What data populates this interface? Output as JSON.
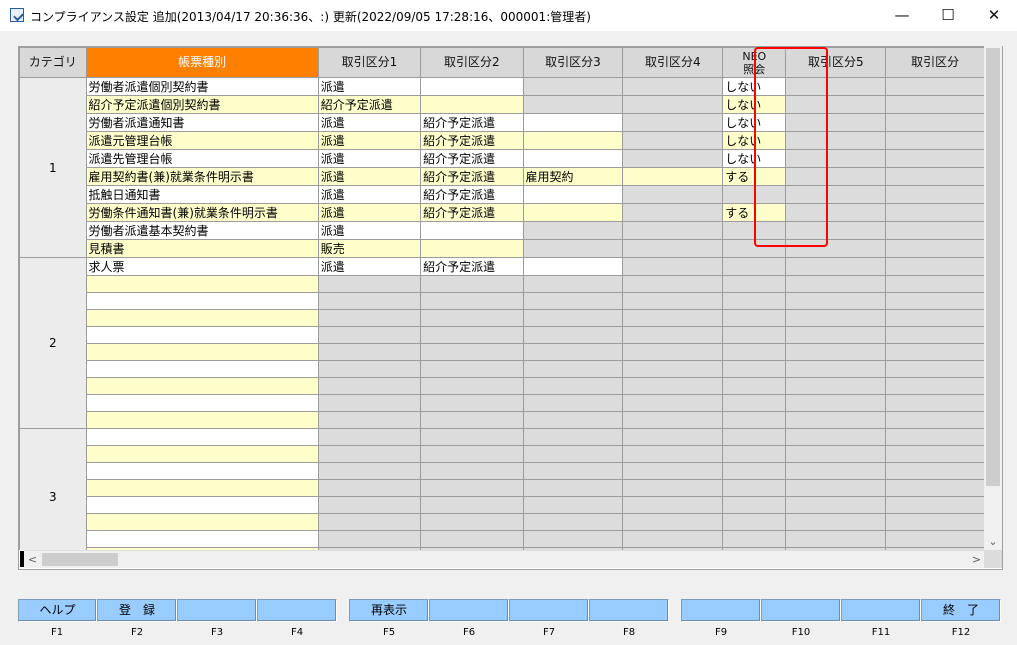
{
  "window": {
    "title": "コンプライアンス設定 追加(2013/04/17 20:36:36、:) 更新(2022/09/05 17:28:16、000001:管理者)",
    "minimize": "—",
    "maximize": "☐",
    "close": "✕"
  },
  "grid": {
    "headers": [
      "カテゴリ",
      "帳票種別",
      "取引区分1",
      "取引区分2",
      "取引区分3",
      "取引区分4",
      "NEO\n照会",
      "取引区分5",
      "取引区分"
    ],
    "categories": [
      {
        "label": "1",
        "rows": [
          [
            "労働者派遣個別契約書",
            "派遣",
            "",
            "",
            "",
            "しない",
            "",
            ""
          ],
          [
            "紹介予定派遣個別契約書",
            "紹介予定派遣",
            "",
            "",
            "",
            "しない",
            "",
            ""
          ],
          [
            "労働者派遣通知書",
            "派遣",
            "紹介予定派遣",
            "",
            "",
            "しない",
            "",
            ""
          ],
          [
            "派遣元管理台帳",
            "派遣",
            "紹介予定派遣",
            "",
            "",
            "しない",
            "",
            ""
          ],
          [
            "派遣先管理台帳",
            "派遣",
            "紹介予定派遣",
            "",
            "",
            "しない",
            "",
            ""
          ],
          [
            "雇用契約書(兼)就業条件明示書",
            "派遣",
            "紹介予定派遣",
            "雇用契約",
            "",
            "する",
            "",
            ""
          ],
          [
            "抵触日通知書",
            "派遣",
            "紹介予定派遣",
            "",
            "",
            "",
            "",
            ""
          ],
          [
            "労働条件通知書(兼)就業条件明示書",
            "派遣",
            "紹介予定派遣",
            "",
            "",
            "する",
            "",
            ""
          ],
          [
            "労働者派遣基本契約書",
            "派遣",
            "",
            "",
            "",
            "",
            "",
            ""
          ],
          [
            "見積書",
            "販売",
            "",
            "",
            "",
            "",
            "",
            ""
          ]
        ]
      },
      {
        "label": "2",
        "rows": [
          [
            "求人票",
            "派遣",
            "紹介予定派遣",
            "",
            "",
            "",
            "",
            ""
          ],
          [
            "",
            "",
            "",
            "",
            "",
            "",
            "",
            ""
          ],
          [
            "",
            "",
            "",
            "",
            "",
            "",
            "",
            ""
          ],
          [
            "",
            "",
            "",
            "",
            "",
            "",
            "",
            ""
          ],
          [
            "",
            "",
            "",
            "",
            "",
            "",
            "",
            ""
          ],
          [
            "",
            "",
            "",
            "",
            "",
            "",
            "",
            ""
          ],
          [
            "",
            "",
            "",
            "",
            "",
            "",
            "",
            ""
          ],
          [
            "",
            "",
            "",
            "",
            "",
            "",
            "",
            ""
          ],
          [
            "",
            "",
            "",
            "",
            "",
            "",
            "",
            ""
          ],
          [
            "",
            "",
            "",
            "",
            "",
            "",
            "",
            ""
          ]
        ]
      },
      {
        "label": "3",
        "rows": [
          [
            "",
            "",
            "",
            "",
            "",
            "",
            "",
            ""
          ],
          [
            "",
            "",
            "",
            "",
            "",
            "",
            "",
            ""
          ],
          [
            "",
            "",
            "",
            "",
            "",
            "",
            "",
            ""
          ],
          [
            "",
            "",
            "",
            "",
            "",
            "",
            "",
            ""
          ],
          [
            "",
            "",
            "",
            "",
            "",
            "",
            "",
            ""
          ],
          [
            "",
            "",
            "",
            "",
            "",
            "",
            "",
            ""
          ],
          [
            "",
            "",
            "",
            "",
            "",
            "",
            "",
            ""
          ],
          [
            "",
            "",
            "",
            "",
            "",
            "",
            "",
            ""
          ]
        ]
      }
    ],
    "cell_colors": {
      "white": "#ffffff",
      "yellow": "#ffffcc",
      "gray": "#dcdcdc",
      "header_accent": "#ff8000",
      "highlight": "#ff0000"
    }
  },
  "scrollbar": {
    "left_arrow": "<",
    "right_arrow": ">",
    "down_arrow": "⌄"
  },
  "function_keys": [
    {
      "key": "F1",
      "label": "ヘルプ"
    },
    {
      "key": "F2",
      "label": "登　録"
    },
    {
      "key": "F3",
      "label": ""
    },
    {
      "key": "F4",
      "label": ""
    },
    {
      "key": "F5",
      "label": "再表示"
    },
    {
      "key": "F6",
      "label": ""
    },
    {
      "key": "F7",
      "label": ""
    },
    {
      "key": "F8",
      "label": ""
    },
    {
      "key": "F9",
      "label": ""
    },
    {
      "key": "F10",
      "label": ""
    },
    {
      "key": "F11",
      "label": ""
    },
    {
      "key": "F12",
      "label": "終　了"
    }
  ]
}
